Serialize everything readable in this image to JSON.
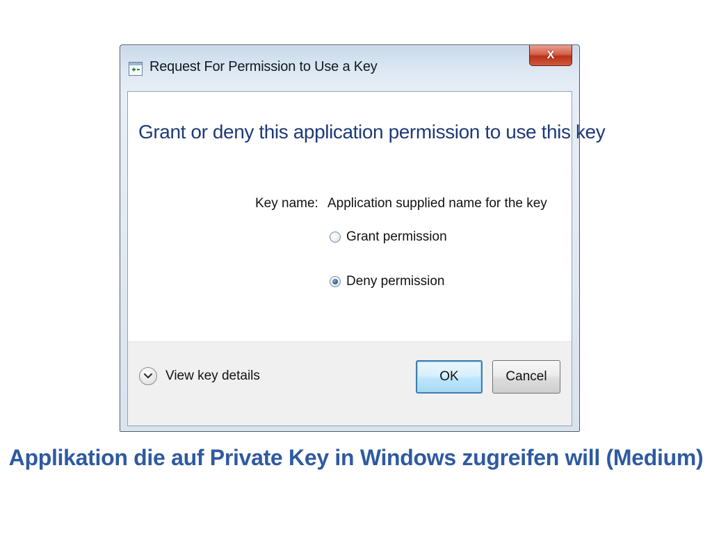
{
  "window": {
    "title": "Request For Permission to Use a Key",
    "close_label": "X"
  },
  "content": {
    "heading": "Grant or deny this application permission to use this key",
    "key_name_label": "Key name:",
    "key_name_value": "Application supplied name for the key",
    "options": [
      {
        "label": "Grant permission",
        "checked": false
      },
      {
        "label": "Deny permission",
        "checked": true
      }
    ]
  },
  "footer": {
    "details_label": "View key details",
    "ok_label": "OK",
    "cancel_label": "Cancel"
  },
  "caption": "Applikation die auf Private Key in Windows zugreifen will (Medium)",
  "colors": {
    "heading": "#1e3a78",
    "caption": "#2e5aa0",
    "close_button": "#c0391e",
    "ok_border": "#3c7fb1"
  },
  "icons": {
    "title_icon": "key-window-icon",
    "details_icon": "chevron-down-icon"
  }
}
